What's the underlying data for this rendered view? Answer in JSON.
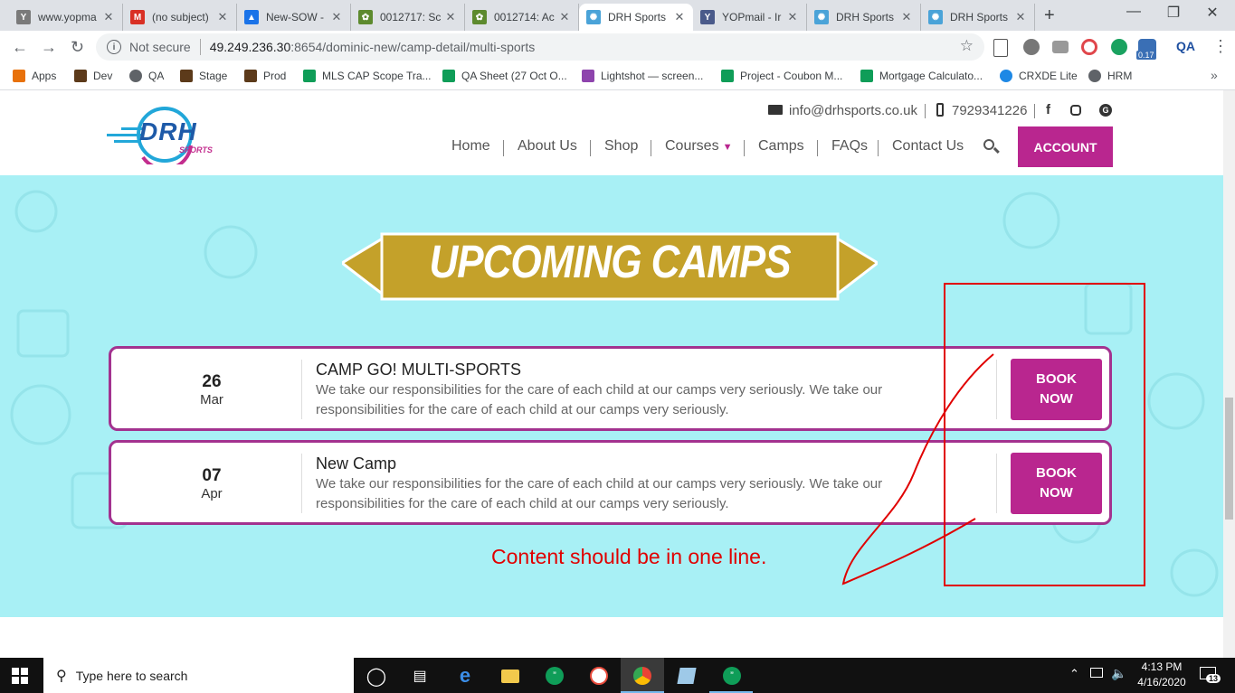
{
  "browser": {
    "tabs": [
      {
        "title": "www.yopma",
        "favicon": "yopmail-icon",
        "color": "#7a7a7a",
        "glyph": "Y"
      },
      {
        "title": "(no subject)",
        "favicon": "gmail-icon",
        "color": "#d93025",
        "glyph": "M"
      },
      {
        "title": "New-SOW -",
        "favicon": "google-drive-icon",
        "color": "#1a73e8",
        "glyph": "▲"
      },
      {
        "title": "0012717: Sc",
        "favicon": "mantis-icon",
        "color": "#5d8a2e",
        "glyph": "✿"
      },
      {
        "title": "0012714: Ac",
        "favicon": "mantis-icon",
        "color": "#5d8a2e",
        "glyph": "✿"
      },
      {
        "title": "DRH Sports",
        "favicon": "drh-icon",
        "color": "#4aa3d8",
        "glyph": "✺",
        "active": true
      },
      {
        "title": "YOPmail - Ir",
        "favicon": "yopmail-icon",
        "color": "#4a5a8a",
        "glyph": "Y"
      },
      {
        "title": "DRH Sports",
        "favicon": "drh-icon",
        "color": "#4aa3d8",
        "glyph": "✺"
      },
      {
        "title": "DRH Sports",
        "favicon": "drh-icon",
        "color": "#4aa3d8",
        "glyph": "✺"
      }
    ],
    "address": {
      "security": "Not secure",
      "host": "49.249.236.30",
      "path": ":8654/dominic-new/camp-detail/multi-sports"
    },
    "extension_badge": "0.17",
    "qa_ext": "QA",
    "bookmarks": [
      {
        "label": "Apps",
        "icon": "apps-grid-icon",
        "color": "#e8710a"
      },
      {
        "label": "Dev",
        "icon": "bookmark-icon",
        "color": "#5c3a1a"
      },
      {
        "label": "QA",
        "icon": "globe-icon",
        "color": "#5f6368"
      },
      {
        "label": "Stage",
        "icon": "bookmark-icon",
        "color": "#5c3a1a"
      },
      {
        "label": "Prod",
        "icon": "bookmark-icon",
        "color": "#5c3a1a"
      },
      {
        "label": "MLS CAP Scope Tra...",
        "icon": "sheets-icon",
        "color": "#0f9d58"
      },
      {
        "label": "QA Sheet (27 Oct O...",
        "icon": "sheets-icon",
        "color": "#0f9d58"
      },
      {
        "label": "Lightshot — screen...",
        "icon": "lightshot-icon",
        "color": "#8e44ad"
      },
      {
        "label": "Project - Coubon M...",
        "icon": "sheets-icon",
        "color": "#0f9d58"
      },
      {
        "label": "Mortgage Calculato...",
        "icon": "sheets-icon",
        "color": "#0f9d58"
      },
      {
        "label": "CRXDE Lite",
        "icon": "crx-icon",
        "color": "#1e88e5"
      },
      {
        "label": "HRM",
        "icon": "globe-icon",
        "color": "#5f6368"
      }
    ]
  },
  "site": {
    "logo_text": "DRH",
    "logo_sub": "SPORTS",
    "email": "info@drhsports.co.uk",
    "phone": "7929341226",
    "nav": [
      "Home",
      "About Us",
      "Shop",
      "Courses",
      "Camps",
      "FAQs",
      "Contact Us"
    ],
    "account_label": "ACCOUNT",
    "section_title": "UPCOMING CAMPS",
    "camps": [
      {
        "day": "26",
        "month": "Mar",
        "title": "CAMP GO! MULTI-SPORTS",
        "description": "We take our responsibilities for the care of each child at our camps very seriously. We take our responsibilities for the care of each child at our camps very seriously.",
        "button_line1": "BOOK",
        "button_line2": "NOW"
      },
      {
        "day": "07",
        "month": "Apr",
        "title": "New Camp",
        "description": "We take our responsibilities for the care of each child at our camps very seriously. We take our responsibilities for the care of each child at our camps very seriously.",
        "button_line1": "BOOK",
        "button_line2": "NOW"
      }
    ],
    "annotation": "Content should be in one line.",
    "colors": {
      "accent": "#b9268f",
      "banner": "#c4a12a",
      "section_bg": "#a8f0f5",
      "annotation": "#e00000"
    }
  },
  "taskbar": {
    "search_placeholder": "Type here to search",
    "time": "4:13 PM",
    "date": "4/16/2020",
    "notifications": "13"
  }
}
